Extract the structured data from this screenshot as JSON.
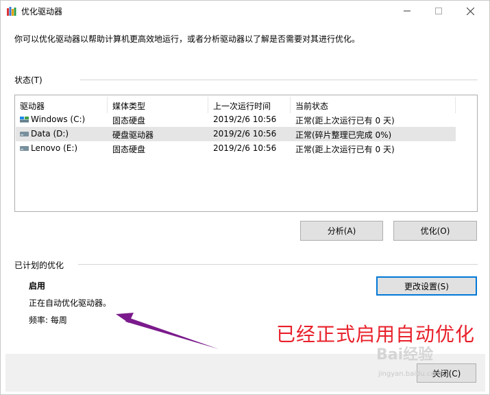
{
  "window": {
    "title": "优化驱动器"
  },
  "description": "你可以优化驱动器以帮助计算机更高效地运行，或者分析驱动器以了解是否需要对其进行优化。",
  "status_section": {
    "label": "状态(T)",
    "columns": [
      "驱动器",
      "媒体类型",
      "上一次运行时间",
      "当前状态"
    ],
    "rows": [
      {
        "drive": "Windows (C:)",
        "media": "固态硬盘",
        "last_run": "2019/2/6 10:56",
        "status": "正常(距上次运行已有 0 天)",
        "icon": "ssd-drive-icon"
      },
      {
        "drive": "Data (D:)",
        "media": "硬盘驱动器",
        "last_run": "2019/2/6 10:56",
        "status": "正常(碎片整理已完成 0%)",
        "icon": "hdd-drive-icon"
      },
      {
        "drive": "Lenovo (E:)",
        "media": "固态硬盘",
        "last_run": "2019/2/6 10:56",
        "status": "正常(距上次运行已有 0 天)",
        "icon": "ssd-drive-icon"
      }
    ]
  },
  "buttons": {
    "analyze": "分析(A)",
    "optimize": "优化(O)",
    "change_settings": "更改设置(S)",
    "close": "关闭(C)"
  },
  "scheduled": {
    "label": "已计划的优化",
    "state": "启用",
    "status_text": "正在自动优化驱动器。",
    "frequency": "频率: 每周"
  },
  "annotation": {
    "text": "已经正式启用自动优化",
    "color": "#e8202a",
    "arrow_color": "#7b1a8c"
  },
  "watermark": {
    "text": "Bai经验",
    "sub": "jingyan.baidu.com"
  }
}
